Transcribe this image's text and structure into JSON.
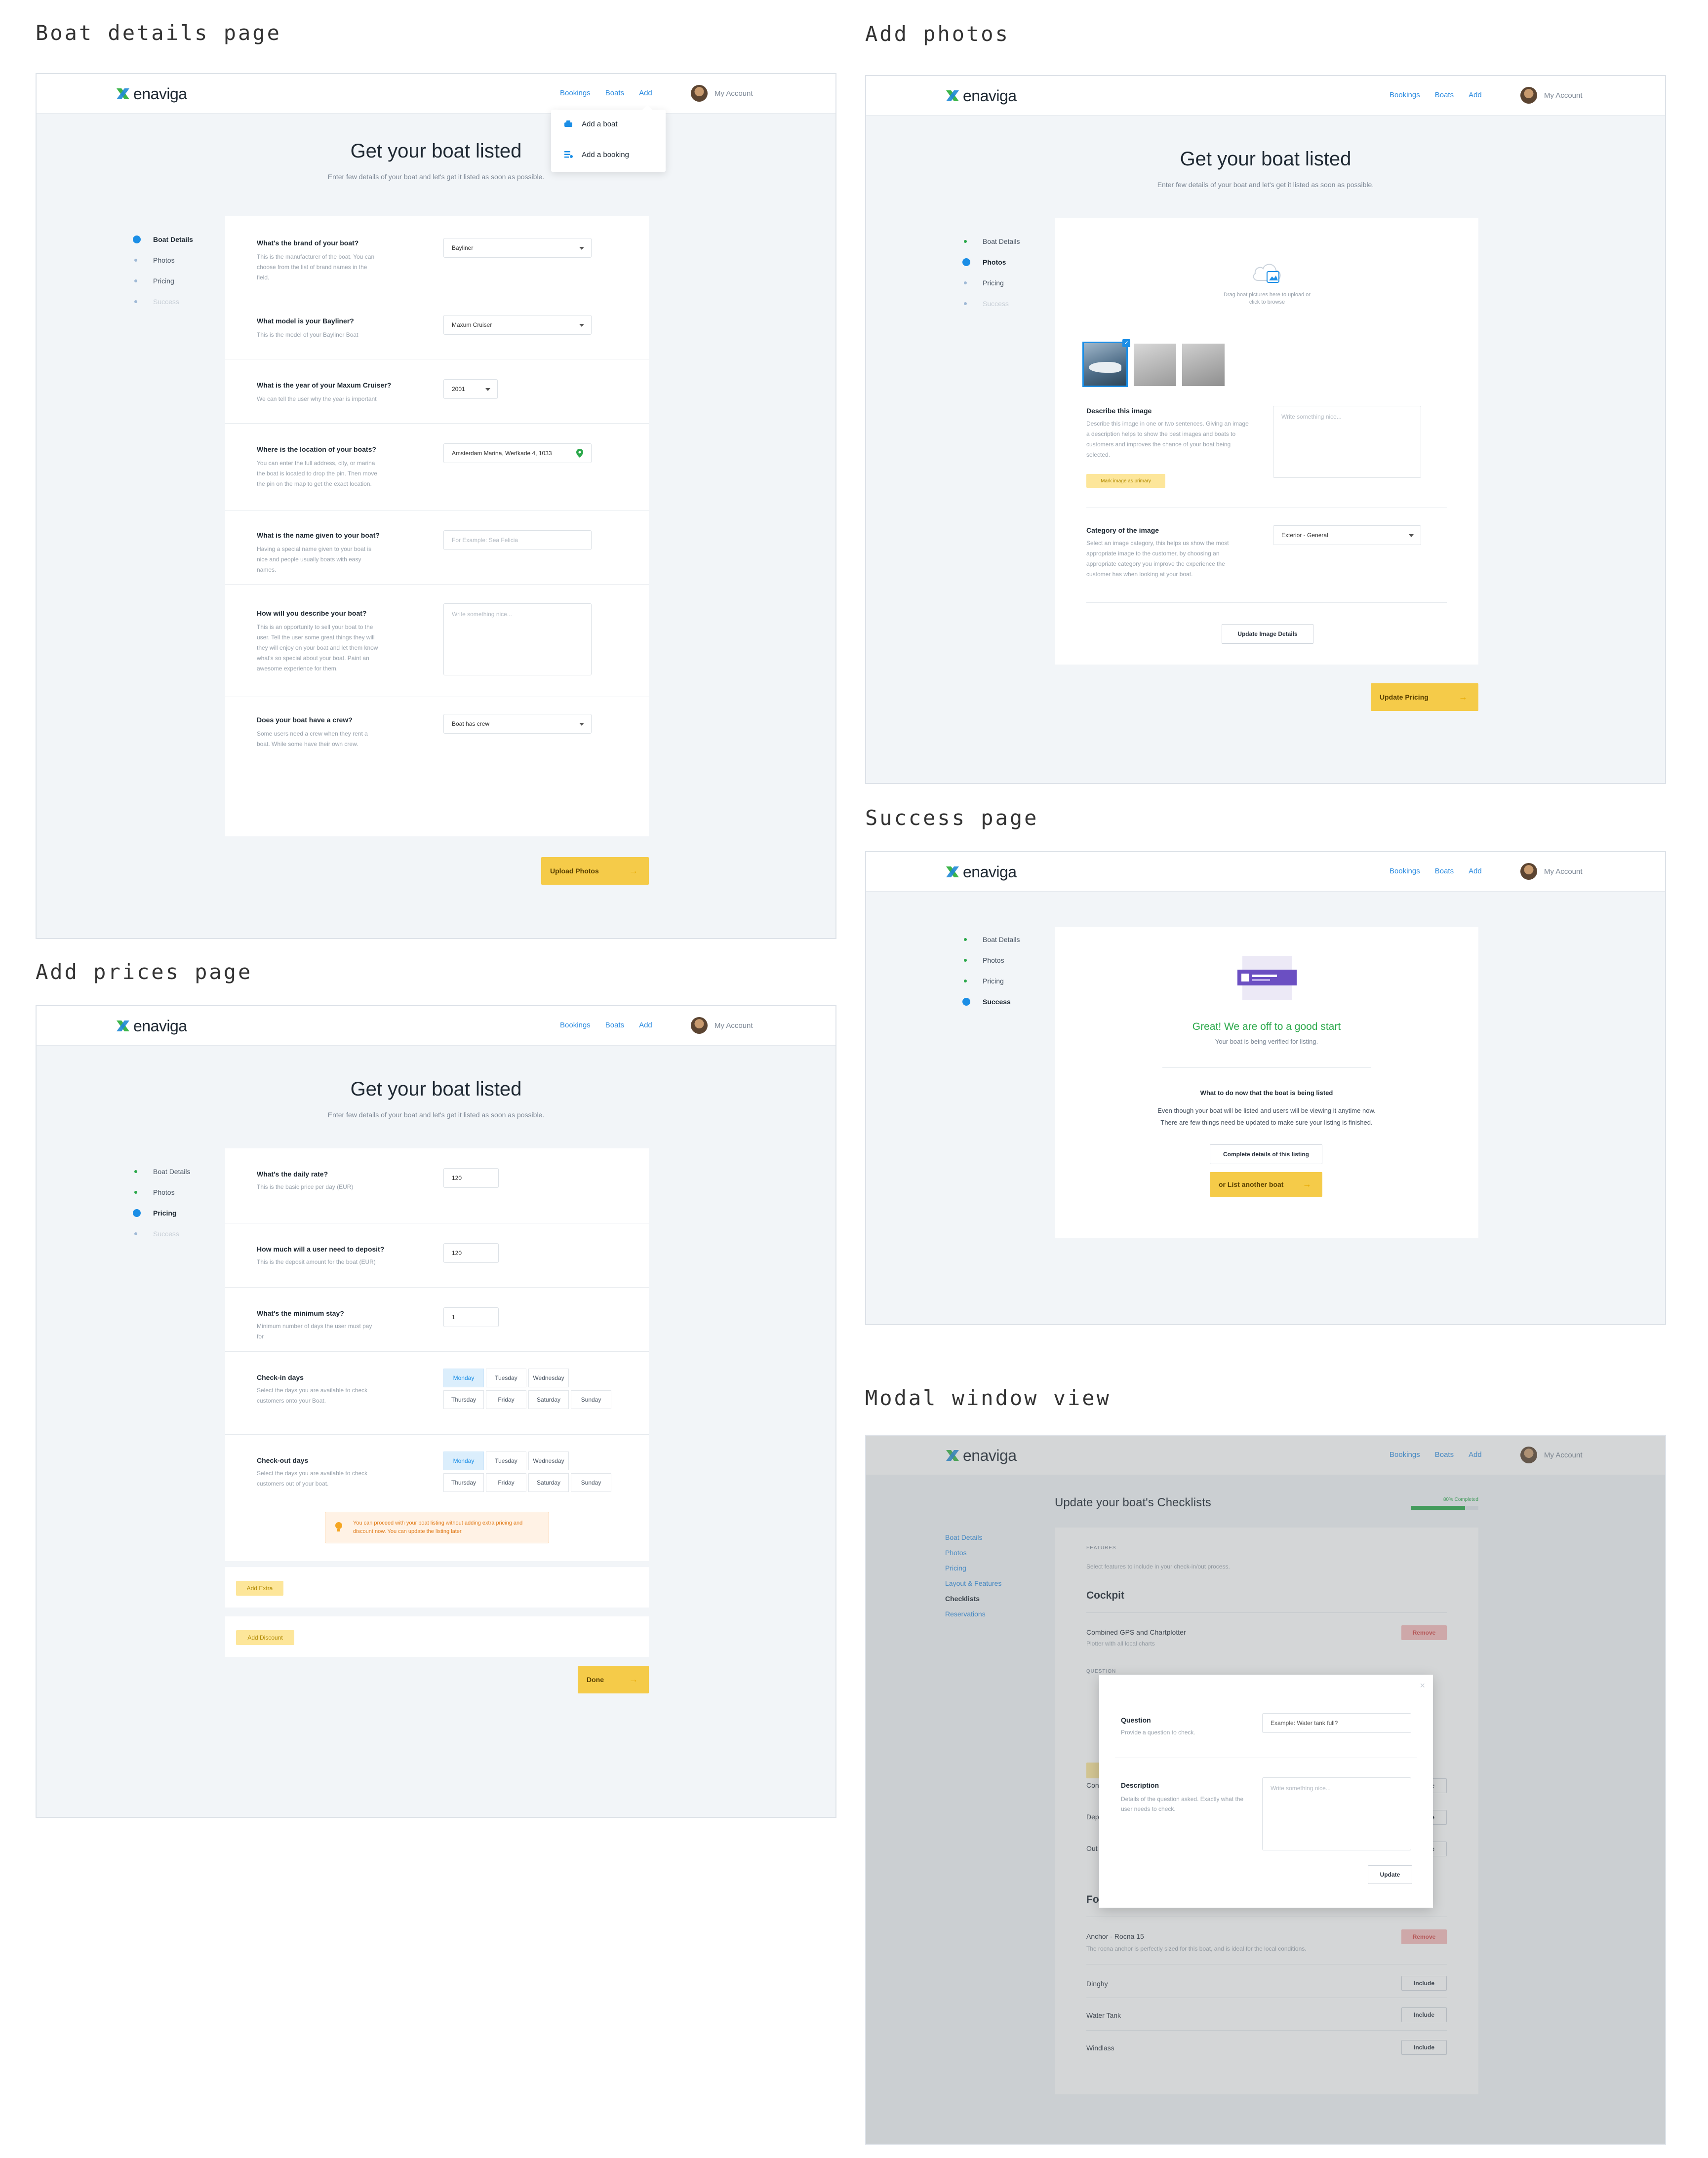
{
  "brand": {
    "name": "enaviga",
    "colors": {
      "accent": "#1b8ee6",
      "cta": "#f5cb49",
      "success": "#2aa84a",
      "danger": "#d24545"
    }
  },
  "nav": {
    "bookings": "Bookings",
    "boats": "Boats",
    "add": "Add",
    "account": "My Account"
  },
  "sections": {
    "details": "Boat details page",
    "photos": "Add photos",
    "prices": "Add prices page",
    "success": "Success page",
    "modal": "Modal window view"
  },
  "header": {
    "title": "Get your boat listed",
    "subtitle": "Enter few details of your boat and let's get it listed as soon as possible."
  },
  "steps": {
    "details": "Boat Details",
    "photos": "Photos",
    "pricing": "Pricing",
    "success": "Success"
  },
  "add_menu": {
    "boat": "Add a boat",
    "booking": "Add a booking"
  },
  "details_form": {
    "brand_q": "What's the brand of your boat?",
    "brand_d": "This is the manufacturer of the boat. You can choose from the list of brand names in the field.",
    "brand_v": "Bayliner",
    "model_q": "What model is your Bayliner?",
    "model_d": "This is the model of your Bayliner Boat",
    "model_v": "Maxum Cruiser",
    "year_q": "What is the year of your Maxum Cruiser?",
    "year_d": "We can tell the user why the year is important",
    "year_v": "2001",
    "loc_q": "Where is the location of your boats?",
    "loc_d": "You can enter the full address, city, or marina the boat is located to drop the pin. Then move the pin on the map to get the exact location.",
    "loc_v": "Amsterdam Marina, Werfkade 4, 1033",
    "name_q": "What is the name given to your boat?",
    "name_d": "Having a special name given to your boat is nice and people usually boats with easy names.",
    "name_ph": "For Example: Sea Felicia",
    "desc_q": "How will you describe your boat?",
    "desc_d": "This is an opportunity to sell your boat to the user. Tell the user some great things they will they will enjoy on your boat and let them know what's so special about your boat. Paint an awesome experience for them.",
    "desc_ph": "Write something nice...",
    "crew_q": "Does your boat have a crew?",
    "crew_d": "Some users need a crew when they rent a boat. While some have their own crew.",
    "crew_v": "Boat has crew",
    "cta": "Upload Photos"
  },
  "photos_form": {
    "drop_text": "Drag boat pictures here to upload or click to browse",
    "describe_q": "Describe this image",
    "describe_d": "Describe this image in one or two sentences. Giving an image a description helps to show the best images and boats to customers and improves the chance of your boat being selected.",
    "describe_ph": "Write something nice...",
    "primary": "Mark image as primary",
    "cat_q": "Category of the image",
    "cat_d": "Select an image category, this helps us show the most appropriate image to the customer, by choosing an appropriate category you improve the experience the customer has when looking at your boat.",
    "cat_v": "Exterior - General",
    "update": "Update Image Details",
    "cta": "Update Pricing"
  },
  "prices_form": {
    "daily_q": "What's the daily rate?",
    "daily_d": "This is the basic price per day (EUR)",
    "daily_v": "120",
    "deposit_q": "How much will a user need to deposit?",
    "deposit_d": "This is the deposit amount for the boat (EUR)",
    "deposit_v": "120",
    "min_q": "What's the minimum stay?",
    "min_d": "Minimum number of days the user must pay for",
    "min_v": "1",
    "checkin_q": "Check-in days",
    "checkin_d": "Select the days you are available to check customers onto your Boat.",
    "checkout_q": "Check-out days",
    "checkout_d": "Select the days you are available to check customers out of your boat.",
    "days": [
      "Monday",
      "Tuesday",
      "Wednesday",
      "Thursday",
      "Friday",
      "Saturday",
      "Sunday"
    ],
    "notice": "You can proceed with your boat listing without adding extra pricing and discount now. You can update the listing later.",
    "add_extra": "Add Extra",
    "add_discount": "Add Discount",
    "cta": "Done"
  },
  "success_page": {
    "title": "Great! We are off to a good start",
    "sub": "Your boat is being verified for listing.",
    "next_q": "What to do now that the boat is being listed",
    "next_d1": "Even though your boat will be listed and users will be viewing it anytime now.",
    "next_d2": "There are few things need be updated to make sure your listing is finished.",
    "complete": "Complete details of this listing",
    "another": "or List another boat"
  },
  "checklist": {
    "title": "Update your boat's Checklists",
    "progress_label": "80% Completed",
    "progress": 0.8,
    "side": [
      "Boat Details",
      "Photos",
      "Pricing",
      "Layout & Features",
      "Checklists",
      "Reservations"
    ],
    "features_label": "FEATURES",
    "features_sub": "Select features to include in your check-in/out process.",
    "cockpit": "Cockpit",
    "gps": "Combined GPS and Chartplotter",
    "gps_sub": "Plotter with all local charts",
    "question_label": "QUESTION",
    "foredeck": "Foredeck",
    "anchor": "Anchor - Rocna 15",
    "anchor_sub": "The rocna anchor is perfectly sized for this boat, and is ideal for the local conditions.",
    "dinghy": "Dinghy",
    "water": "Water Tank",
    "windlass": "Windlass",
    "remove": "Remove",
    "include": "Include",
    "partial": {
      "a": "Con",
      "b": "Dep",
      "c": "Out"
    }
  },
  "modal": {
    "question_q": "Question",
    "question_d": "Provide a question to check.",
    "question_ph": "Example: Water tank full?",
    "desc_q": "Description",
    "desc_d": "Details of the question asked. Exactly what the user needs to check.",
    "desc_ph": "Write something nice...",
    "update": "Update"
  }
}
